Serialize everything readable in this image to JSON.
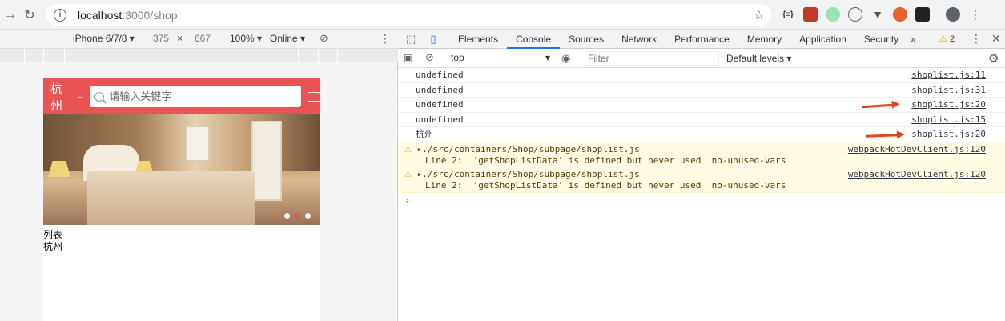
{
  "browser": {
    "url_host": "localhost",
    "url_path": ":3000/shop",
    "ext_labels": [
      "{≡}",
      "",
      "",
      "",
      "",
      "",
      ""
    ]
  },
  "device_toolbar": {
    "device": "iPhone 6/7/8 ▾",
    "width": "375",
    "times": "×",
    "height": "667",
    "zoom": "100% ▾",
    "network": "Online ▾"
  },
  "app": {
    "city": "杭州",
    "search_placeholder": "请输入关键字",
    "list_label": "列表",
    "list_city": "杭州"
  },
  "devtools": {
    "tabs": [
      "Elements",
      "Console",
      "Sources",
      "Network",
      "Performance",
      "Memory",
      "Application",
      "Security"
    ],
    "more_tabs": "»",
    "warning_count": "2",
    "context": "top",
    "filter_placeholder": "Filter",
    "levels": "Default levels ▾"
  },
  "console": {
    "logs": [
      {
        "text": "undefined",
        "source": "shoplist.js:11"
      },
      {
        "text": "undefined",
        "source": "shoplist.js:31"
      },
      {
        "text": "undefined",
        "source": "shoplist.js:20"
      },
      {
        "text": "undefined",
        "source": "shoplist.js:15"
      },
      {
        "text": "杭州",
        "source": "shoplist.js:20"
      }
    ],
    "warnings": [
      {
        "line1": "▸./src/containers/Shop/subpage/shoplist.js",
        "line2": "Line 2:  'getShopListData' is defined but never used  no-unused-vars",
        "source": "webpackHotDevClient.js:120"
      },
      {
        "line1": "▸./src/containers/Shop/subpage/shoplist.js",
        "line2": "Line 2:  'getShopListData' is defined but never used  no-unused-vars",
        "source": "webpackHotDevClient.js:120"
      }
    ],
    "prompt": "›"
  },
  "colors": {
    "header_red": "#e95353",
    "arrow_red": "#e8411f",
    "warning_bg": "#fffbe5"
  }
}
